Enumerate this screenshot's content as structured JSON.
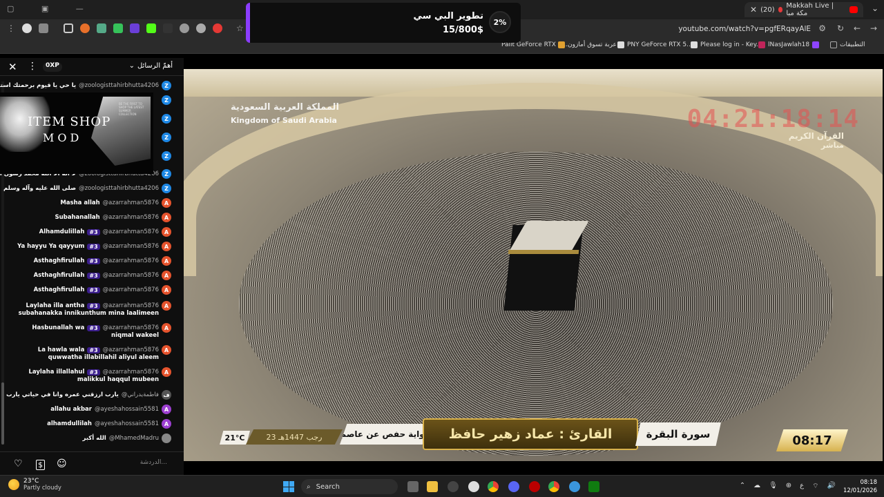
{
  "browser": {
    "active_tab": {
      "title": "(20) 🔴 Makkah Live | مكة مباشر",
      "count": "(20)"
    },
    "url": "youtube.com/watch?v=pgfERqayAlE",
    "bookmarks": [
      {
        "label": "Palit GeForce RTX 5...",
        "color": "#777"
      },
      {
        "label": "عربة تسوق أمازون",
        "color": "#e0a030"
      },
      {
        "label": "PNY GeForce RTX 5...",
        "color": "#ddd"
      },
      {
        "label": "Please log in - Key...",
        "color": "#ddd"
      },
      {
        "label": "lNasJawlah18",
        "color": "#8e44ff"
      },
      {
        "label": "التطبيقات",
        "color": "#aaa"
      }
    ]
  },
  "popup": {
    "title": "تطوير البي سي",
    "value": "15/800$",
    "percent": "2%",
    "accent": "#8b3dff"
  },
  "chat": {
    "header": {
      "filter": "أهمّ الرسائل",
      "xp": "0XP"
    },
    "badge": "#3",
    "overlay": {
      "line1": "ITEM SHOP",
      "line2": "MOD",
      "fine_print": "BE THE FIRST TO SHOP THE LATEST SUMMER COLLECTION"
    },
    "messages": [
      {
        "author": "@zoologisttahirbhutta4206",
        "text": "يا حي يا قيوم برحمتك استغيث",
        "avatar": "Z",
        "color": "#1e88e5",
        "badge": false
      },
      {
        "author": "",
        "text": "",
        "avatar": "Z",
        "color": "#1e88e5",
        "badge": false
      },
      {
        "author": "",
        "text": "",
        "avatar": "Z",
        "color": "#1e88e5",
        "badge": false
      },
      {
        "author": "",
        "text": "",
        "avatar": "Z",
        "color": "#1e88e5",
        "badge": false
      },
      {
        "author": "",
        "text": "",
        "avatar": "Z",
        "color": "#1e88e5",
        "badge": false
      },
      {
        "author": "@zoologisttahirbhutta4206",
        "text": "لا اله الا الله محمد رسول الله",
        "avatar": "Z",
        "color": "#1e88e5",
        "badge": false
      },
      {
        "author": "@zoologisttahirbhutta4206",
        "text": "صلى الله عليه وآله وسلم",
        "avatar": "Z",
        "color": "#1e88e5",
        "badge": false
      },
      {
        "author": "@azarrahman5876",
        "text": "Masha allah",
        "avatar": "A",
        "color": "#e5532d",
        "badge": false
      },
      {
        "author": "@azarrahman5876",
        "text": "Subahanallah",
        "avatar": "A",
        "color": "#e5532d",
        "badge": false
      },
      {
        "author": "@azarrahman5876",
        "text": "Alhamdulillah",
        "avatar": "A",
        "color": "#e5532d",
        "badge": true
      },
      {
        "author": "@azarrahman5876",
        "text": "Ya hayyu Ya qayyum",
        "avatar": "A",
        "color": "#e5532d",
        "badge": true
      },
      {
        "author": "@azarrahman5876",
        "text": "Asthaghfirullah",
        "avatar": "A",
        "color": "#e5532d",
        "badge": true
      },
      {
        "author": "@azarrahman5876",
        "text": "Asthaghfirullah",
        "avatar": "A",
        "color": "#e5532d",
        "badge": true
      },
      {
        "author": "@azarrahman5876",
        "text": "Asthaghfirullah",
        "avatar": "A",
        "color": "#e5532d",
        "badge": true
      },
      {
        "author": "@azarrahman5876",
        "text": "Laylaha illa antha",
        "text2": "subahanakka innikunthum mina laalimeen",
        "avatar": "A",
        "color": "#e5532d",
        "badge": true
      },
      {
        "author": "@azarrahman5876",
        "text": "Hasbunallah wa",
        "text2": "niqmal wakeel",
        "avatar": "A",
        "color": "#e5532d",
        "badge": true
      },
      {
        "author": "@azarrahman5876",
        "text": "La hawla wala",
        "text2": "quwwatha illabillahil aliyul aleem",
        "avatar": "A",
        "color": "#e5532d",
        "badge": true
      },
      {
        "author": "@azarrahman5876",
        "text": "Laylaha illallahul",
        "text2": "malikkul haqqul mubeen",
        "avatar": "A",
        "color": "#e5532d",
        "badge": true
      },
      {
        "author": "@فاطمةيدراني",
        "text": "يارب ارزقني عمره وانا في حياتي يارب",
        "avatar": "ف",
        "color": "#555555",
        "badge": false
      },
      {
        "author": "@ayeshahossain5581",
        "text": "allahu akbar",
        "avatar": "A",
        "color": "#9c3fd0",
        "badge": false
      },
      {
        "author": "@ayeshahossain5581",
        "text": "alhamdullilah",
        "avatar": "A",
        "color": "#9c3fd0",
        "badge": false
      },
      {
        "author": "@MhamedMadru",
        "text": "الله أكبر",
        "avatar": "",
        "color": "#888888",
        "badge": false
      }
    ],
    "input_placeholder": "الدردشة..."
  },
  "video": {
    "watermark_ar": "المملكة العربية السعودية",
    "watermark_en": "Kingdom of Saudi Arabia",
    "clock": "04:21:18:14",
    "channel": "القرآن الكريم",
    "live": "مباشر",
    "reader": "القارئ : عماد زهير حافظ",
    "surah": "سورة البقرة",
    "riwaya": "رواية حفص عن عاصم",
    "hijri_date": "23 رجب 1447هـ",
    "temp": "21°C",
    "time": "08:17"
  },
  "taskbar": {
    "weather_temp": "23°C",
    "weather_desc": "Partly cloudy",
    "search": "Search",
    "time": "08:18",
    "date": "12/01/2026"
  }
}
